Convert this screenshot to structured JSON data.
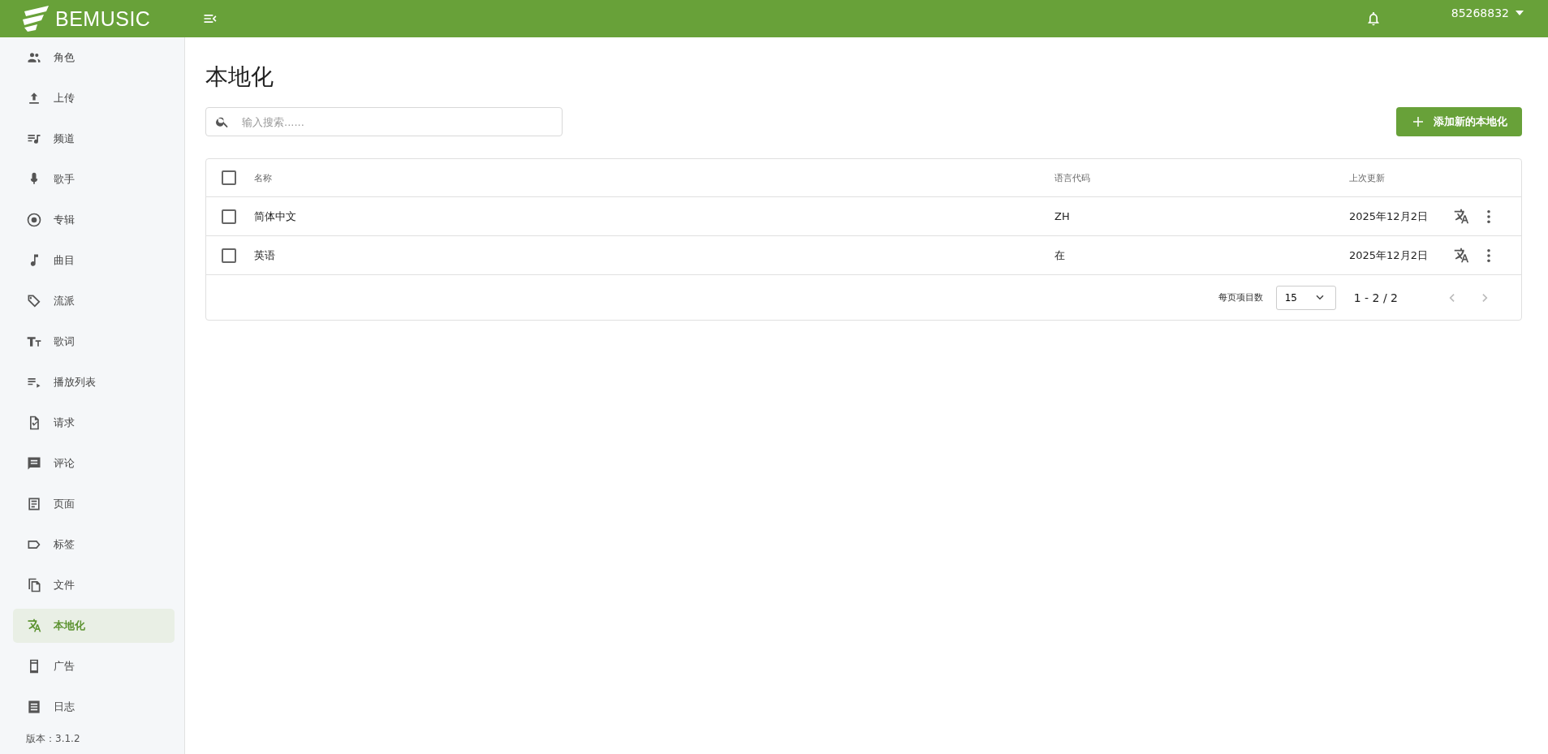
{
  "header": {
    "logo": "BEMUSIC",
    "user": "85268832"
  },
  "sidebar": {
    "items": [
      {
        "label": "角色",
        "selected": false
      },
      {
        "label": "上传",
        "selected": false
      },
      {
        "label": "频道",
        "selected": false
      },
      {
        "label": "歌手",
        "selected": false
      },
      {
        "label": "专辑",
        "selected": false
      },
      {
        "label": "曲目",
        "selected": false
      },
      {
        "label": "流派",
        "selected": false
      },
      {
        "label": "歌词",
        "selected": false
      },
      {
        "label": "播放列表",
        "selected": false
      },
      {
        "label": "请求",
        "selected": false
      },
      {
        "label": "评论",
        "selected": false
      },
      {
        "label": "页面",
        "selected": false
      },
      {
        "label": "标签",
        "selected": false
      },
      {
        "label": "文件",
        "selected": false
      },
      {
        "label": "本地化",
        "selected": true
      },
      {
        "label": "广告",
        "selected": false
      },
      {
        "label": "日志",
        "selected": false
      }
    ],
    "version": "版本：3.1.2"
  },
  "page": {
    "title": "本地化",
    "search": {
      "placeholder": "输入搜索......"
    },
    "add_button": "添加新的本地化"
  },
  "table": {
    "columns": [
      "名称",
      "语言代码",
      "上次更新"
    ],
    "select_all_checked": false,
    "rows": [
      {
        "name": "简体中文",
        "code": "ZH",
        "updated": "2025年12月2日",
        "checked": false
      },
      {
        "name": "英语",
        "code": "在",
        "updated": "2025年12月2日",
        "checked": false
      }
    ],
    "footer": {
      "per_page_label": "每页项目数",
      "per_page": "15",
      "range": "1 - 2 / 2"
    }
  }
}
